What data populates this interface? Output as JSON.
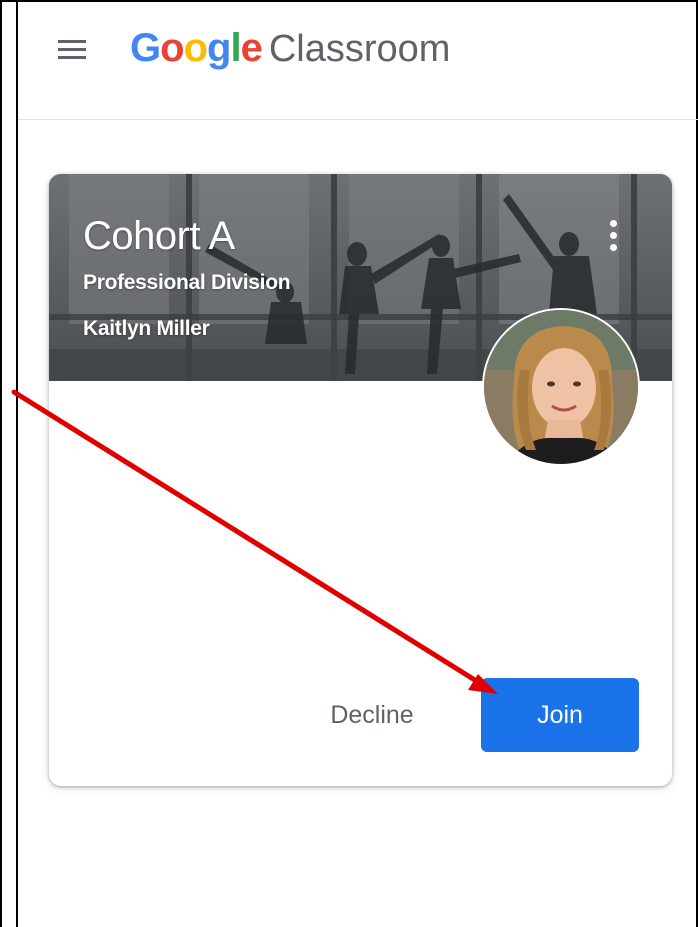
{
  "header": {
    "menu_icon": "hamburger-menu-icon",
    "logo_letters": [
      {
        "char": "G",
        "color": "#4285F4"
      },
      {
        "char": "o",
        "color": "#EA4335"
      },
      {
        "char": "o",
        "color": "#FBBC05"
      },
      {
        "char": "g",
        "color": "#4285F4"
      },
      {
        "char": "l",
        "color": "#34A853"
      },
      {
        "char": "e",
        "color": "#EA4335"
      }
    ],
    "product_name": "Classroom"
  },
  "class_card": {
    "title": "Cohort A",
    "section": "Professional Division",
    "teacher": "Kaitlyn Miller",
    "more_icon": "more-vert-icon",
    "decline_label": "Decline",
    "join_label": "Join"
  },
  "colors": {
    "join_button": "#1a73e8",
    "annotation_arrow": "#e00000",
    "secondary_text": "#5f6368"
  }
}
